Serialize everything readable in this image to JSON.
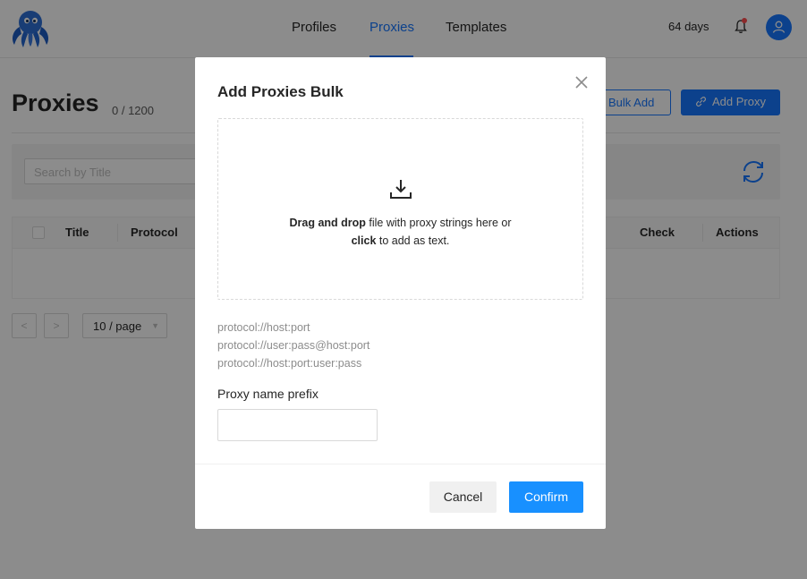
{
  "nav": {
    "items": [
      {
        "label": "Profiles"
      },
      {
        "label": "Proxies"
      },
      {
        "label": "Templates"
      }
    ],
    "days_left": "64 days"
  },
  "page": {
    "title": "Proxies",
    "count": "0 / 1200",
    "bulk_add_label": "Bulk Add",
    "add_proxy_label": "Add Proxy",
    "search_placeholder": "Search by Title",
    "columns": {
      "title": "Title",
      "protocol": "Protocol",
      "check": "Check",
      "actions": "Actions"
    },
    "pagination": {
      "prev": "<",
      "next": ">",
      "page_size": "10 / page"
    }
  },
  "modal": {
    "title": "Add Proxies Bulk",
    "drop_bold1": "Drag and drop",
    "drop_text1": " file with proxy strings here or",
    "drop_bold2": "click",
    "drop_text2": " to add as text.",
    "formats": [
      "protocol://host:port",
      "protocol://user:pass@host:port",
      "protocol://host:port:user:pass"
    ],
    "prefix_label": "Proxy name prefix",
    "prefix_value": "",
    "cancel_label": "Cancel",
    "confirm_label": "Confirm"
  },
  "colors": {
    "primary": "#1677ff",
    "confirm": "#1890ff",
    "notification": "#ff4d4f",
    "overlay": "rgba(0,0,0,0.45)"
  }
}
